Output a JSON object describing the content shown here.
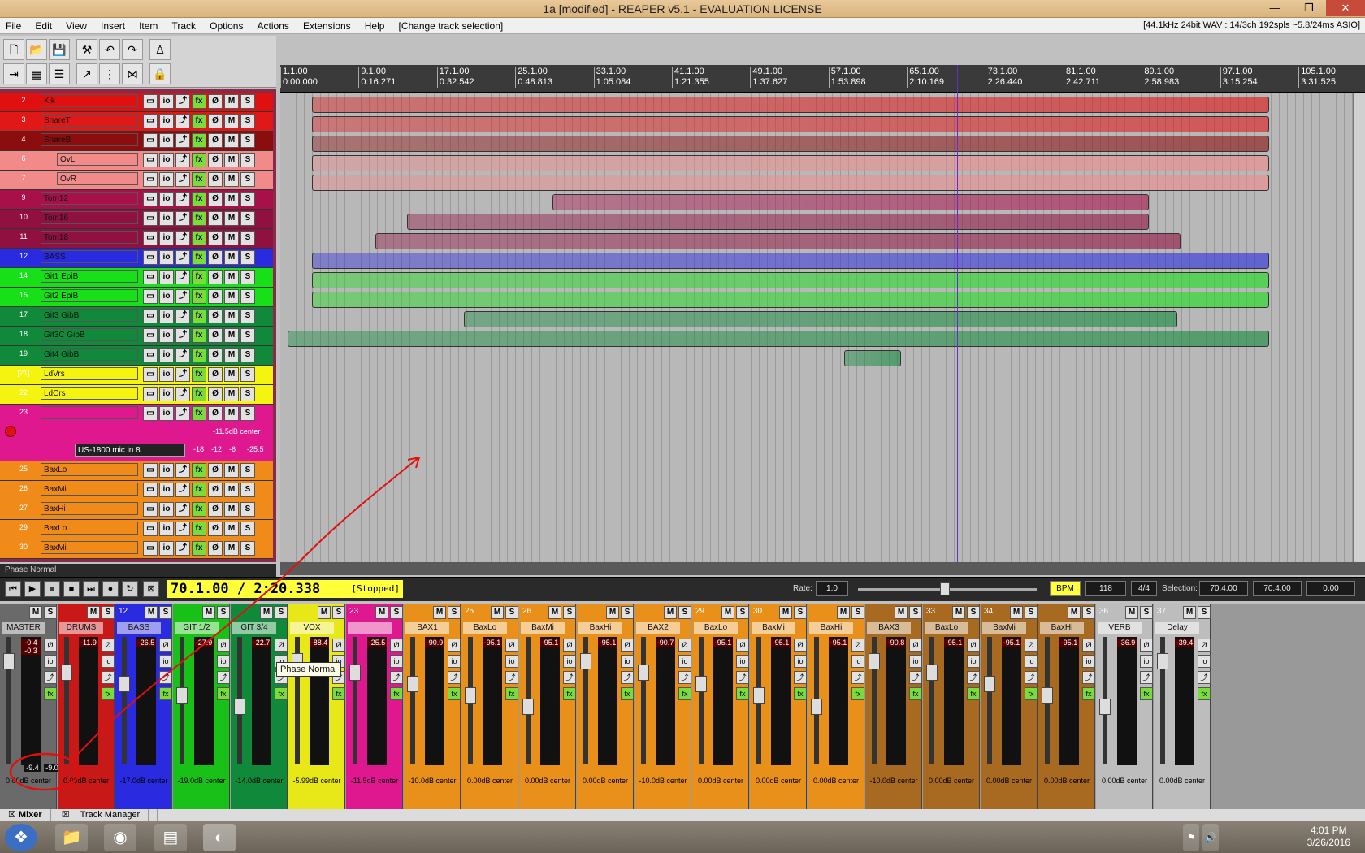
{
  "window": {
    "title": "1a [modified] - REAPER v5.1 - EVALUATION LICENSE",
    "min": "—",
    "max": "❐",
    "close": "✕"
  },
  "menu": [
    "File",
    "Edit",
    "View",
    "Insert",
    "Item",
    "Track",
    "Options",
    "Actions",
    "Extensions",
    "Help",
    "[Change track selection]"
  ],
  "audio_status": "[44.1kHz 24bit WAV : 14/3ch 192spls ~5.8/24ms ASIO]",
  "tcp_buttons": {
    "io": "io",
    "fx": "fx",
    "m": "M",
    "s": "S",
    "env": "⤴"
  },
  "tracks": [
    {
      "num": "2",
      "name": "Kik",
      "color": "#e01010"
    },
    {
      "num": "3",
      "name": "SnareT",
      "color": "#e01818"
    },
    {
      "num": "4",
      "name": "SnareB",
      "color": "#8b0d0d"
    },
    {
      "num": "6",
      "name": "OvL",
      "color": "#f28a8a"
    },
    {
      "num": "7",
      "name": "OvR",
      "color": "#f28a8a"
    },
    {
      "num": "9",
      "name": "Tom12",
      "color": "#a8104a"
    },
    {
      "num": "10",
      "name": "Tom16",
      "color": "#901040"
    },
    {
      "num": "11",
      "name": "Tom18",
      "color": "#901040"
    },
    {
      "num": "12",
      "name": "BASS",
      "color": "#2a2ae0"
    },
    {
      "num": "14",
      "name": "Git1 EpiB",
      "color": "#18e018"
    },
    {
      "num": "15",
      "name": "Git2 EpiB",
      "color": "#18e018"
    },
    {
      "num": "17",
      "name": "Git3 GibB",
      "color": "#108a3a"
    },
    {
      "num": "18",
      "name": "Git3C GibB",
      "color": "#108a3a"
    },
    {
      "num": "19",
      "name": "Git4 GibB",
      "color": "#108a3a"
    },
    {
      "num": "[21]",
      "name": "LdVrs",
      "color": "#f4f410"
    },
    {
      "num": "22",
      "name": "LdCrs",
      "color": "#f4f410"
    },
    {
      "num": "23",
      "name": "",
      "color": "#e01890"
    },
    {
      "num": "25",
      "name": "BaxLo",
      "color": "#f08a18"
    },
    {
      "num": "26",
      "name": "BaxMi",
      "color": "#f08a18"
    },
    {
      "num": "27",
      "name": "BaxHi",
      "color": "#f08a18"
    },
    {
      "num": "29",
      "name": "BaxLo",
      "color": "#f08a18"
    },
    {
      "num": "30",
      "name": "BaxMi",
      "color": "#f08a18"
    }
  ],
  "track23": {
    "vol": "-11.5dB center",
    "input": "US-1800 mic in 8",
    "meter": [
      "-18",
      "-12",
      "-6",
      "-25.5"
    ]
  },
  "phase_status": "Phase Normal",
  "ruler": [
    {
      "bar": "1.1.00",
      "time": "0:00.000"
    },
    {
      "bar": "9.1.00",
      "time": "0:16.271"
    },
    {
      "bar": "17.1.00",
      "time": "0:32.542"
    },
    {
      "bar": "25.1.00",
      "time": "0:48.813"
    },
    {
      "bar": "33.1.00",
      "time": "1:05.084"
    },
    {
      "bar": "41.1.00",
      "time": "1:21.355"
    },
    {
      "bar": "49.1.00",
      "time": "1:37.627"
    },
    {
      "bar": "57.1.00",
      "time": "1:53.898"
    },
    {
      "bar": "65.1.00",
      "time": "2:10.169"
    },
    {
      "bar": "73.1.00",
      "time": "2:26.440"
    },
    {
      "bar": "81.1.00",
      "time": "2:42.711"
    },
    {
      "bar": "89.1.00",
      "time": "2:58.983"
    },
    {
      "bar": "97.1.00",
      "time": "3:15.254"
    },
    {
      "bar": "105.1.00",
      "time": "3:31.525"
    }
  ],
  "transport": {
    "time": "70.1.00 / 2:20.338",
    "state": "[Stopped]",
    "rate_label": "Rate:",
    "rate": "1.0",
    "bpm_label": "BPM",
    "bpm": "118",
    "sig": "4/4",
    "sel_label": "Selection:",
    "sel_start": "70.4.00",
    "sel_end": "70.4.00",
    "sel_len": "0.00"
  },
  "mixer": [
    {
      "num": "",
      "name": "MASTER",
      "color": "#6a6a6a",
      "peak": "-0.4  -0.3",
      "vol": "0.00dB center"
    },
    {
      "num": "",
      "name": "DRUMS",
      "color": "#c81818",
      "peak": "-11.9",
      "vol": "0.00dB center"
    },
    {
      "num": "12",
      "name": "BASS",
      "color": "#2a2ae0",
      "peak": "-26.5",
      "vol": "-17.0dB center"
    },
    {
      "num": "",
      "name": "GIT 1/2",
      "color": "#18c018",
      "peak": "-27.9",
      "vol": "-19.0dB center"
    },
    {
      "num": "",
      "name": "GIT 3/4",
      "color": "#108a3a",
      "peak": "-22.7",
      "vol": "-14.0dB center"
    },
    {
      "num": "",
      "name": "VOX",
      "color": "#e8e818",
      "peak": "-88.4",
      "vol": "-5.99dB center"
    },
    {
      "num": "23",
      "name": "",
      "color": "#e01890",
      "peak": "-25.5",
      "vol": "-11.5dB center"
    },
    {
      "num": "",
      "name": "BAX1",
      "color": "#e8901a",
      "peak": "-90.9",
      "vol": "-10.0dB center"
    },
    {
      "num": "25",
      "name": "BaxLo",
      "color": "#e8901a",
      "peak": "-95.1",
      "vol": "0.00dB center"
    },
    {
      "num": "26",
      "name": "BaxMi",
      "color": "#e8901a",
      "peak": "-95.1",
      "vol": "0.00dB center"
    },
    {
      "num": "",
      "name": "BaxHi",
      "color": "#e8901a",
      "peak": "-95.1",
      "vol": "0.00dB center"
    },
    {
      "num": "",
      "name": "BAX2",
      "color": "#e8901a",
      "peak": "-90.7",
      "vol": "-10.0dB center"
    },
    {
      "num": "29",
      "name": "BaxLo",
      "color": "#e8901a",
      "peak": "-95.1",
      "vol": "0.00dB center"
    },
    {
      "num": "30",
      "name": "BaxMi",
      "color": "#e8901a",
      "peak": "-95.1",
      "vol": "0.00dB center"
    },
    {
      "num": "",
      "name": "BaxHi",
      "color": "#e8901a",
      "peak": "-95.1",
      "vol": "0.00dB center"
    },
    {
      "num": "",
      "name": "BAX3",
      "color": "#a86a20",
      "peak": "-90.8",
      "vol": "-10.0dB center"
    },
    {
      "num": "33",
      "name": "BaxLo",
      "color": "#a86a20",
      "peak": "-95.1",
      "vol": "0.00dB center"
    },
    {
      "num": "34",
      "name": "BaxMi",
      "color": "#a86a20",
      "peak": "-95.1",
      "vol": "0.00dB center"
    },
    {
      "num": "",
      "name": "BaxHi",
      "color": "#a86a20",
      "peak": "-95.1",
      "vol": "0.00dB center"
    },
    {
      "num": "36",
      "name": "VERB",
      "color": "#bdbdbd",
      "peak": "-36.9",
      "vol": "0.00dB center"
    },
    {
      "num": "37",
      "name": "Delay",
      "color": "#bdbdbd",
      "peak": "-39.4",
      "vol": "0.00dB center"
    }
  ],
  "master_bottom": [
    "-9.4",
    "-9.0"
  ],
  "tooltip": "Phase Normal",
  "mixer_tabs": [
    "Mixer",
    "Track Manager"
  ],
  "clock": {
    "time": "4:01 PM",
    "date": "3/26/2016"
  },
  "colors": {
    "arrange_bg": "#b8b8b8",
    "cursor": "#6a2ad0",
    "annotation": "#e01010"
  }
}
